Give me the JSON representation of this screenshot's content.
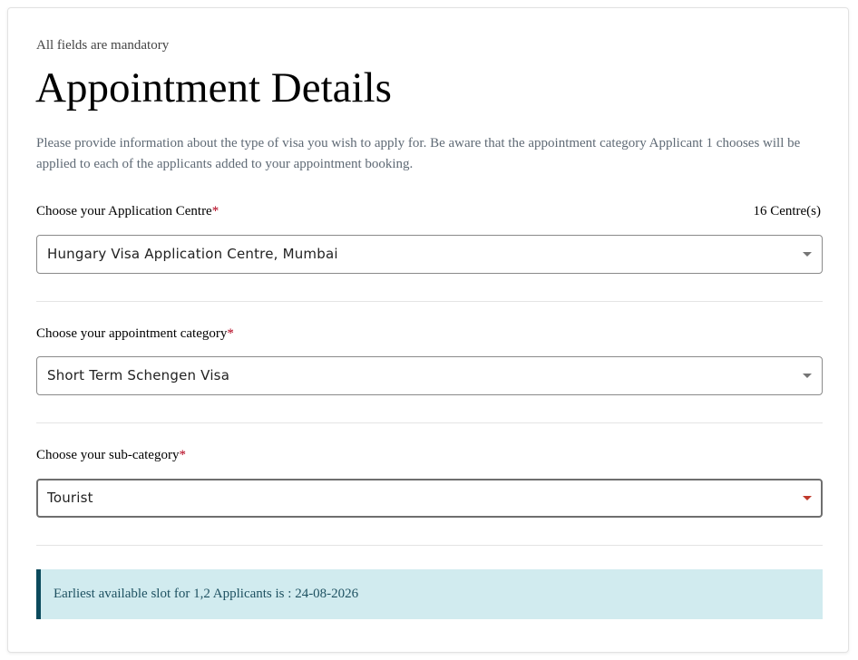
{
  "form": {
    "mandatory_note": "All fields are mandatory",
    "title": "Appointment Details",
    "intro": "Please provide information about the type of visa you wish to apply for. Be aware that the appointment category Applicant 1 chooses will be applied to each of the applicants added to your appointment booking.",
    "required_marker": "*"
  },
  "centre": {
    "label": "Choose your Application Centre",
    "count": "16 Centre(s)",
    "value": "Hungary Visa Application Centre, Mumbai"
  },
  "category": {
    "label": "Choose your appointment category",
    "value": "Short Term Schengen Visa"
  },
  "subcategory": {
    "label": "Choose your sub-category",
    "value": "Tourist"
  },
  "slot": {
    "message": "Earliest available slot for 1,2 Applicants is : 24-08-2026"
  },
  "colors": {
    "required": "#b3001b",
    "alert_bg": "#d1ebef",
    "alert_border": "#0b4a5c",
    "focused_caret": "#c0392b"
  },
  "icons": {
    "dropdown": "chevron-down-icon"
  }
}
